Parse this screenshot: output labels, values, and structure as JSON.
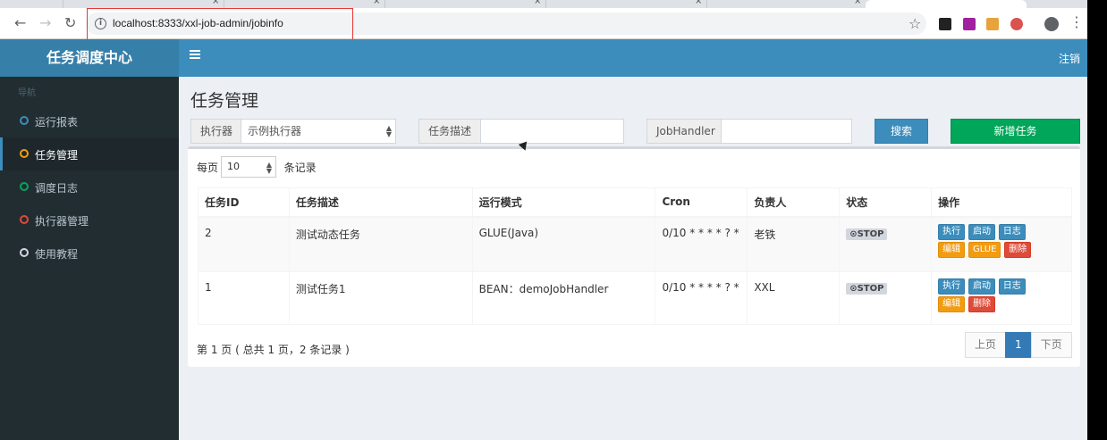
{
  "browser": {
    "url": "localhost:8333/xxl-job-admin/jobinfo"
  },
  "header": {
    "logo": "任务调度中心",
    "logout": "注销"
  },
  "sidebar": {
    "header": "导航",
    "items": [
      {
        "label": "运行报表",
        "color": "#3c8dbc"
      },
      {
        "label": "任务管理",
        "color": "#f39c12"
      },
      {
        "label": "调度日志",
        "color": "#00a65a"
      },
      {
        "label": "执行器管理",
        "color": "#dd4b39"
      },
      {
        "label": "使用教程",
        "color": "#d2d6de"
      }
    ]
  },
  "main": {
    "title": "任务管理",
    "filters": {
      "executor_label": "执行器",
      "executor_value": "示例执行器",
      "desc_label": "任务描述",
      "handler_label": "JobHandler",
      "search": "搜索",
      "add": "新增任务"
    },
    "page_size": {
      "prefix": "每页",
      "value": "10",
      "suffix": "条记录"
    },
    "table": {
      "columns": [
        "任务ID",
        "任务描述",
        "运行模式",
        "Cron",
        "负责人",
        "状态",
        "操作"
      ],
      "rows": [
        {
          "id": "2",
          "desc": "测试动态任务",
          "mode": "GLUE(Java)",
          "cron": "0/10 * * * * ? *",
          "owner": "老铁",
          "status": "⊙STOP",
          "actions": [
            "执行",
            "启动",
            "日志",
            "编辑",
            "GLUE",
            "删除"
          ]
        },
        {
          "id": "1",
          "desc": "测试任务1",
          "mode": "BEAN：demoJobHandler",
          "cron": "0/10 * * * * ? *",
          "owner": "XXL",
          "status": "⊙STOP",
          "actions": [
            "执行",
            "启动",
            "日志",
            "编辑",
            "删除"
          ]
        }
      ]
    },
    "pager": {
      "info": "第 1 页 ( 总共 1 页，2 条记录 )",
      "prev": "上页",
      "current": "1",
      "next": "下页"
    }
  }
}
